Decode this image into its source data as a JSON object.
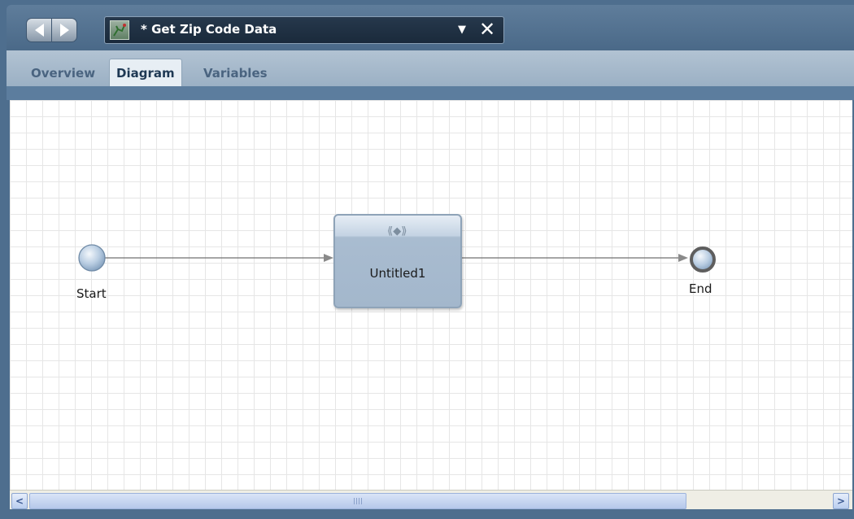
{
  "editor": {
    "title": "* Get Zip Code Data",
    "dropdown_glyph": "▼",
    "close_glyph": "✕"
  },
  "view_tabs": [
    {
      "label": "Overview"
    },
    {
      "label": "Diagram",
      "active": true
    },
    {
      "label": "Variables"
    }
  ],
  "diagram": {
    "nodes": {
      "start": {
        "label": "Start",
        "type": "start-event"
      },
      "activity": {
        "label": "Untitled1",
        "type": "activity",
        "icon": "⟪◆⟫"
      },
      "end": {
        "label": "End",
        "type": "end-event"
      }
    },
    "edges": [
      {
        "from": "start",
        "to": "activity"
      },
      {
        "from": "activity",
        "to": "end"
      }
    ]
  },
  "scrollbar": {
    "left_glyph": "<",
    "right_glyph": ">"
  },
  "colors": {
    "frame": "#4e6e8e",
    "canvas_grid": "#e6e6e6",
    "activity_fill": "#a9bcd0"
  }
}
